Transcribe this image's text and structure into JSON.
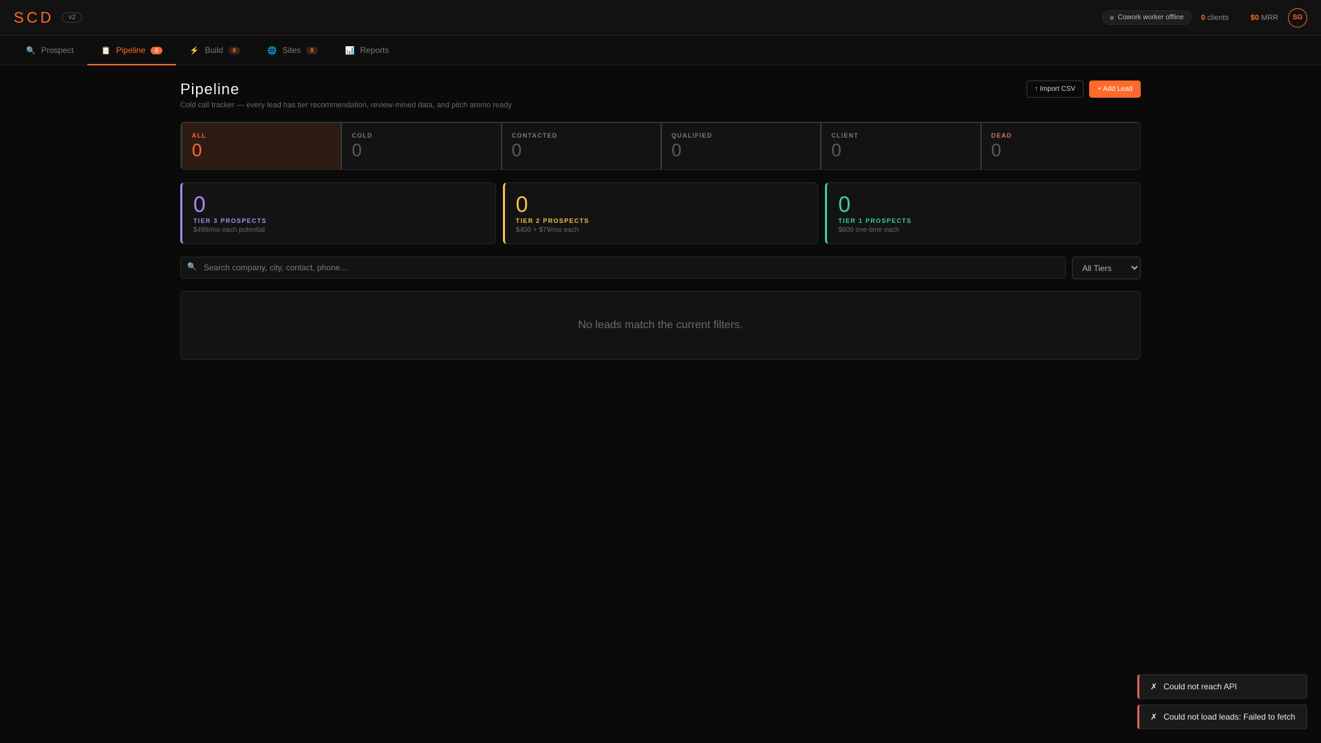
{
  "header": {
    "logo": "SCD",
    "version": "v2",
    "worker_status": "Cowork worker offline",
    "clients_count": "0",
    "clients_label": "clients",
    "separator": "·",
    "mrr_value": "$0",
    "mrr_label": "MRR",
    "avatar_initials": "SG"
  },
  "tabs": [
    {
      "label": "Prospect",
      "icon": "🔍",
      "icon_name": "search-icon",
      "badge": null,
      "active": false
    },
    {
      "label": "Pipeline",
      "icon": "📋",
      "icon_name": "clipboard-icon",
      "badge": "0",
      "active": true
    },
    {
      "label": "Build",
      "icon": "⚡",
      "icon_name": "lightning-icon",
      "badge": "0",
      "active": false
    },
    {
      "label": "Sites",
      "icon": "🌐",
      "icon_name": "globe-icon",
      "badge": "0",
      "active": false
    },
    {
      "label": "Reports",
      "icon": "📊",
      "icon_name": "bar-chart-icon",
      "badge": null,
      "active": false
    }
  ],
  "page": {
    "title": "Pipeline",
    "subtitle": "Cold call tracker — every lead has tier recommendation, review-mined data, and pitch ammo ready",
    "import_label": "↑ Import CSV",
    "add_label": "+ Add Lead"
  },
  "statuses": [
    {
      "label": "ALL",
      "value": "0"
    },
    {
      "label": "COLD",
      "value": "0"
    },
    {
      "label": "CONTACTED",
      "value": "0"
    },
    {
      "label": "QUALIFIED",
      "value": "0"
    },
    {
      "label": "CLIENT",
      "value": "0"
    },
    {
      "label": "DEAD",
      "value": "0"
    }
  ],
  "tiers": [
    {
      "count": "0",
      "label": "TIER 3 PROSPECTS",
      "desc": "$499/mo each potential",
      "color": "#a98bf0"
    },
    {
      "count": "0",
      "label": "TIER 2 PROSPECTS",
      "desc": "$400 + $79/mo each",
      "color": "#f2c14e"
    },
    {
      "count": "0",
      "label": "TIER 1 PROSPECTS",
      "desc": "$800 one-time each",
      "color": "#3ecf9a"
    }
  ],
  "filters": {
    "search_icon": "🔍",
    "search_placeholder": "Search company, city, contact, phone...",
    "tier_selected": "All Tiers"
  },
  "empty_message": "No leads match the current filters.",
  "toasts": [
    {
      "icon": "✗",
      "message": "Could not reach API"
    },
    {
      "icon": "✗",
      "message": "Could not load leads: Failed to fetch"
    }
  ],
  "colors": {
    "accent": "#ff6a2c",
    "error": "#e2635a"
  }
}
